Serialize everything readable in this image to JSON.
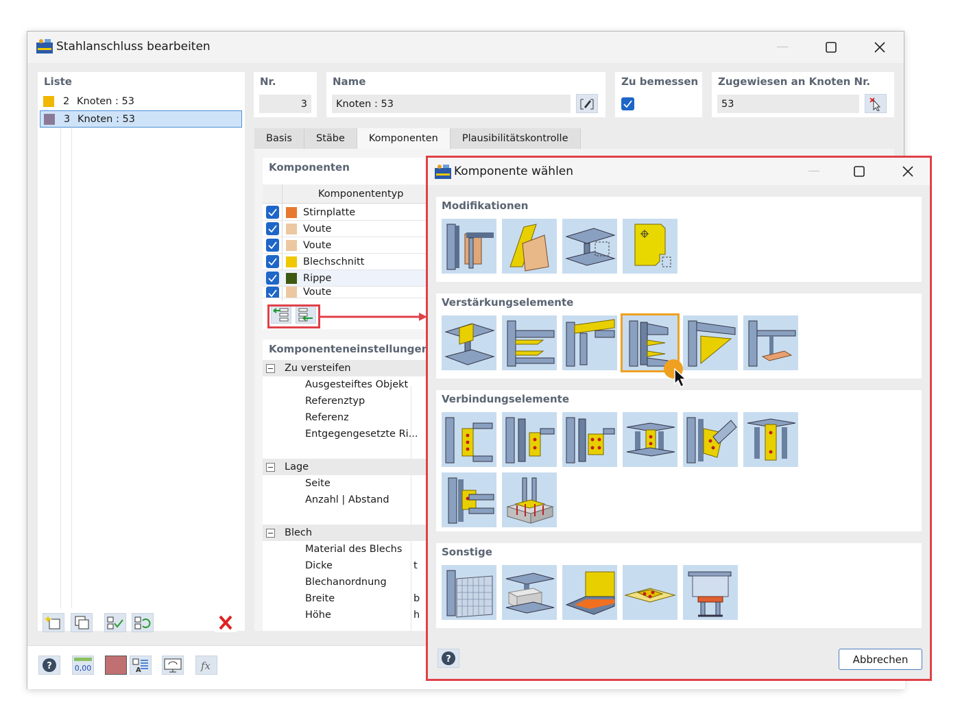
{
  "window": {
    "title": "Stahlanschluss bearbeiten"
  },
  "liste": {
    "label": "Liste",
    "items": [
      {
        "num": "2",
        "text": "Knoten : 53",
        "color": "#f0b800"
      },
      {
        "num": "3",
        "text": "Knoten : 53",
        "color": "#8a7a98"
      }
    ]
  },
  "header": {
    "nr_label": "Nr.",
    "nr_value": "3",
    "name_label": "Name",
    "name_value": "Knoten : 53",
    "bemessen_label": "Zu bemessen",
    "knoten_label": "Zugewiesen an Knoten Nr.",
    "knoten_value": "53"
  },
  "tabs": [
    "Basis",
    "Stäbe",
    "Komponenten",
    "Plausibilitätskontrolle"
  ],
  "komponenten": {
    "label": "Komponenten",
    "column": "Komponententyp",
    "rows": [
      {
        "name": "Stirnplatte",
        "color": "#e87830"
      },
      {
        "name": "Voute",
        "color": "#ecc8a0"
      },
      {
        "name": "Voute",
        "color": "#ecc8a0"
      },
      {
        "name": "Blechschnitt",
        "color": "#f0c800"
      },
      {
        "name": "Rippe",
        "color": "#3d5a10"
      },
      {
        "name": "Voute",
        "color": "#ecc8a0"
      }
    ]
  },
  "settings": {
    "label": "Komponenteneinstellungen",
    "groups": [
      {
        "name": "Zu versteifen",
        "items": [
          {
            "n": "Ausgesteiftes Objekt",
            "s": ""
          },
          {
            "n": "Referenztyp",
            "s": ""
          },
          {
            "n": "Referenz",
            "s": ""
          },
          {
            "n": "Entgegengesetzte Ri...",
            "s": ""
          }
        ]
      },
      {
        "name": "Lage",
        "items": [
          {
            "n": "Seite",
            "s": ""
          },
          {
            "n": "Anzahl | Abstand",
            "s": ""
          }
        ]
      },
      {
        "name": "Blech",
        "items": [
          {
            "n": "Material des Blechs",
            "s": ""
          },
          {
            "n": "Dicke",
            "s": "t"
          },
          {
            "n": "Blechanordnung",
            "s": ""
          },
          {
            "n": "Breite",
            "s": "b"
          },
          {
            "n": "Höhe",
            "s": "h"
          }
        ]
      }
    ]
  },
  "dialog": {
    "title": "Komponente wählen",
    "sections": [
      "Modifikationen",
      "Verstärkungselemente",
      "Verbindungselemente",
      "Sonstige"
    ],
    "cancel": "Abbrechen"
  },
  "bottom_toolbar": {
    "decimal_label": "0,00",
    "fx_label": "fx"
  },
  "colors": {
    "accent": "#1e66c8",
    "highlight": "#e04048",
    "selected_tile": "#f0a020"
  }
}
